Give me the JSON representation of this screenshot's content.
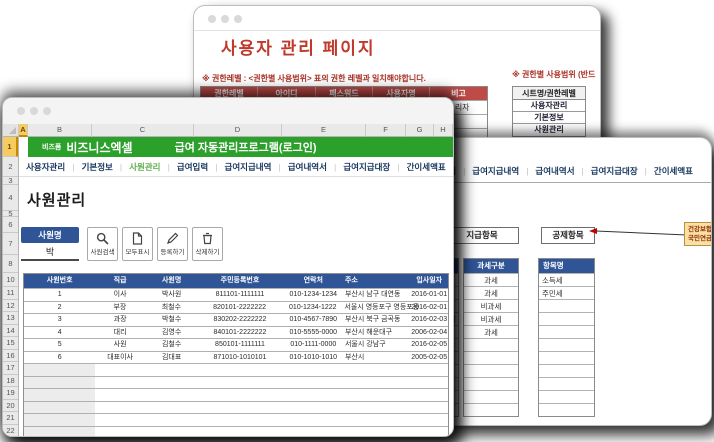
{
  "back_window": {
    "title": "사용자 관리 페이지",
    "note": "※ 권한레벨 : <권한별 사용범위> 표의 권한 레벨과 일치해야합니다.",
    "user_table": {
      "headers": [
        "권한레벨",
        "아이디",
        "패스워드",
        "사용자명",
        "비고"
      ],
      "rows": [
        [
          "",
          "",
          "",
          "",
          "관리자"
        ],
        [
          "",
          "",
          "",
          "",
          ""
        ],
        [
          "",
          "",
          "",
          "",
          ""
        ]
      ]
    },
    "scope_note": "※ 권한별 사용범위 (반드",
    "scope_table": {
      "header": "시트명/권한레벨",
      "rows": [
        "사용자관리",
        "기본정보",
        "사원관리"
      ]
    }
  },
  "mid_window": {
    "tabs": [
      "급여입력",
      "급여지급내역",
      "급여내역서",
      "급여지급대장",
      "간이세액표"
    ],
    "pay_label": "지급항목",
    "deduction_label": "공제항목",
    "callout_line1": "건강보험료, 장기",
    "callout_line2": "국민연금은 입력",
    "hidden_col_partial": "비",
    "tax_table": {
      "header": "과세구분",
      "rows": [
        "과세",
        "과세",
        "비과세",
        "비과세",
        "과세",
        "",
        "",
        "",
        "",
        "",
        ""
      ]
    },
    "item_table": {
      "header": "항목명",
      "rows": [
        "소득세",
        "주민세",
        "",
        "",
        "",
        "",
        "",
        "",
        "",
        "",
        ""
      ]
    }
  },
  "front_window": {
    "brand_prefix": "비즈폼",
    "brand": "비즈니스엑셀",
    "app_title": "급여 자동관리프로그램(로그인)",
    "tabs": [
      "사용자관리",
      "기본정보",
      "사원관리",
      "급여입력",
      "급여지급내역",
      "급여내역서",
      "급여지급대장",
      "간이세액표"
    ],
    "active_tab": "사원관리",
    "column_headers": [
      "A",
      "B",
      "C",
      "D",
      "E",
      "F",
      "G",
      "H"
    ],
    "row_numbers": [
      "1",
      "2",
      "3",
      "4",
      "5",
      "6",
      "7",
      "8",
      "10",
      "11",
      "12",
      "13",
      "14",
      "15",
      "16",
      "17",
      "18",
      "19",
      "20",
      "21",
      "22"
    ],
    "section_title": "사원관리",
    "filter": {
      "label": "사원명",
      "value": "박"
    },
    "action_buttons": [
      {
        "label": "사원검색",
        "icon": "search-icon"
      },
      {
        "label": "모두표시",
        "icon": "document-icon"
      },
      {
        "label": "등록하기",
        "icon": "pencil-icon"
      },
      {
        "label": "삭제하기",
        "icon": "trash-icon"
      }
    ],
    "employee_table": {
      "headers": [
        "사원번호",
        "직급",
        "사원명",
        "주민등록번호",
        "연락처",
        "주소",
        "입사일자"
      ],
      "rows": [
        [
          "1",
          "이사",
          "박사원",
          "811101-1111111",
          "010-1234-1234",
          "부산시 남구 대연동",
          "2016-01-01"
        ],
        [
          "2",
          "부장",
          "최철수",
          "820101-2222222",
          "010-1234-1222",
          "서울시 영등포구 영등포동",
          "2016-02-01"
        ],
        [
          "3",
          "과장",
          "박철수",
          "830202-2222222",
          "010-4567-7890",
          "부산시 북구 금곡동",
          "2016-02-03"
        ],
        [
          "4",
          "대리",
          "김영수",
          "840101-2222222",
          "010-5555-0000",
          "부산시 해운대구",
          "2006-02-04"
        ],
        [
          "5",
          "사원",
          "김철수",
          "850101-1111111",
          "010-1111-0000",
          "서울시 강남구",
          "2016-02-05"
        ],
        [
          "6",
          "대표이사",
          "김대표",
          "871010-1010101",
          "010-1010-1010",
          "부산시",
          "2005-02-05"
        ]
      ],
      "empty_rows": 6
    }
  },
  "colors": {
    "banner_green": "#2BA02B",
    "header_blue": "#2F5597",
    "title_red": "#C0392B",
    "table_red": "#BE4B48",
    "tab_navy": "#17375E",
    "active_tab_green": "#5FAE4F",
    "callout_bg": "#FBE0A6"
  }
}
